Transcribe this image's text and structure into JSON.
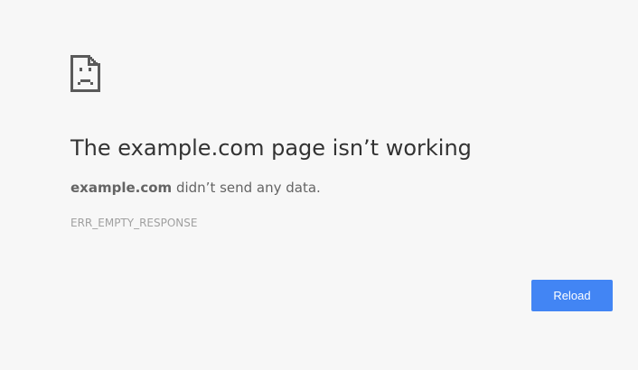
{
  "error_page": {
    "icon": "sad-page-icon",
    "title": "The example.com page isn’t working",
    "summary": {
      "host": "example.com",
      "message": " didn’t send any data."
    },
    "error_code": "ERR_EMPTY_RESPONSE",
    "reload_label": "Reload"
  },
  "colors": {
    "background": "#f7f7f7",
    "title_text": "#333333",
    "body_text": "#646464",
    "code_text": "#a0a0a0",
    "button_blue": "#4285f4",
    "button_text": "#ffffff"
  }
}
